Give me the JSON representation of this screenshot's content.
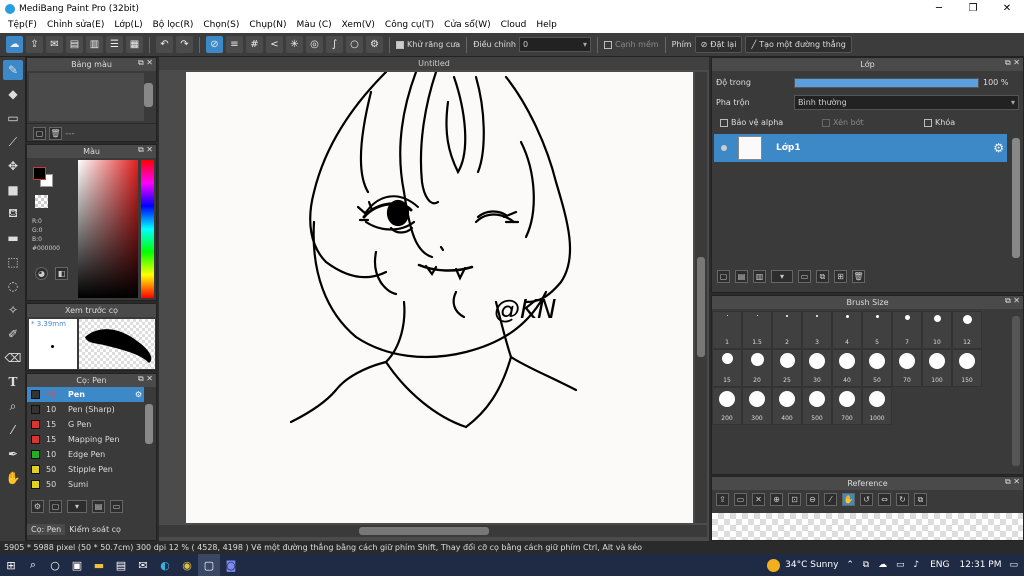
{
  "window": {
    "title": "MediBang Paint Pro (32bit)",
    "minimize": "─",
    "maximize": "❐",
    "close": "✕"
  },
  "menu": [
    "Tệp(F)",
    "Chỉnh sửa(E)",
    "Lớp(L)",
    "Bộ lọc(R)",
    "Chọn(S)",
    "Chụp(N)",
    "Màu (C)",
    "Xem(V)",
    "Công cụ(T)",
    "Cửa sổ(W)",
    "Cloud",
    "Help"
  ],
  "toolbar": {
    "antialias_label": "Khử răng cưa",
    "adjust_label": "Điều chỉnh",
    "adjust_value": "0",
    "edge_label": "Cạnh mềm",
    "key_label": "Phím",
    "reset_label": "Đặt lại",
    "create_line_label": "Tạo một đường thẳng"
  },
  "panels": {
    "palette": {
      "title": "Bảng màu",
      "count": "---"
    },
    "color": {
      "title": "Màu",
      "r": "R:0",
      "g": "G:0",
      "b": "B:0",
      "hex": "#000000"
    },
    "preview": {
      "title": "Xem trước cọ",
      "size": "* 3.39mm"
    },
    "brush": {
      "title": "Cọ: Pen",
      "tab1": "Cọ: Pen",
      "tab2": "Kiểm soát cọ"
    },
    "layer": {
      "title": "Lớp",
      "opacity_label": "Độ trong",
      "opacity_value": "100 %",
      "opacity_fraction": 1.0,
      "blend_label": "Pha trộn",
      "blend_value": "Bình thường",
      "alpha_label": "Bảo vệ alpha",
      "clip_label": "Xén bớt",
      "lock_label": "Khóa",
      "layer_name": "Lớp1"
    },
    "brush_size": {
      "title": "Brush Size"
    },
    "reference": {
      "title": "Reference"
    }
  },
  "brushes": [
    {
      "size": "40",
      "name": "Pen",
      "color": "#333333",
      "selected": true
    },
    {
      "size": "10",
      "name": "Pen (Sharp)",
      "color": "#333333"
    },
    {
      "size": "15",
      "name": "G Pen",
      "color": "#e03030"
    },
    {
      "size": "15",
      "name": "Mapping Pen",
      "color": "#e03030"
    },
    {
      "size": "10",
      "name": "Edge Pen",
      "color": "#20b020"
    },
    {
      "size": "50",
      "name": "Stipple Pen",
      "color": "#e0d020"
    },
    {
      "size": "50",
      "name": "Sumi",
      "color": "#e0d020"
    }
  ],
  "brush_sizes": [
    "1",
    "1.5",
    "2",
    "3",
    "4",
    "5",
    "7",
    "10",
    "12",
    "15",
    "20",
    "25",
    "30",
    "40",
    "50",
    "70",
    "100",
    "150",
    "200",
    "300",
    "400",
    "500",
    "700",
    "1000"
  ],
  "canvas": {
    "doc_title": "Untitled",
    "signature": "@KN"
  },
  "status": {
    "text": "5905 * 5988 pixel  (50 * 50.7cm)  300 dpi   12 %  ( 4528, 4198 )  Vẽ một đường thẳng bằng cách giữ phím Shift, Thay đổi cỡ cọ bằng cách giữ phím Ctrl, Alt và kéo"
  },
  "taskbar": {
    "weather": "34°C  Sunny",
    "lang": "ENG",
    "time": "12:31 PM"
  },
  "colors": {
    "accent": "#3d88c7",
    "titlebar": "#ffffff",
    "panel": "#3a3a3a"
  }
}
